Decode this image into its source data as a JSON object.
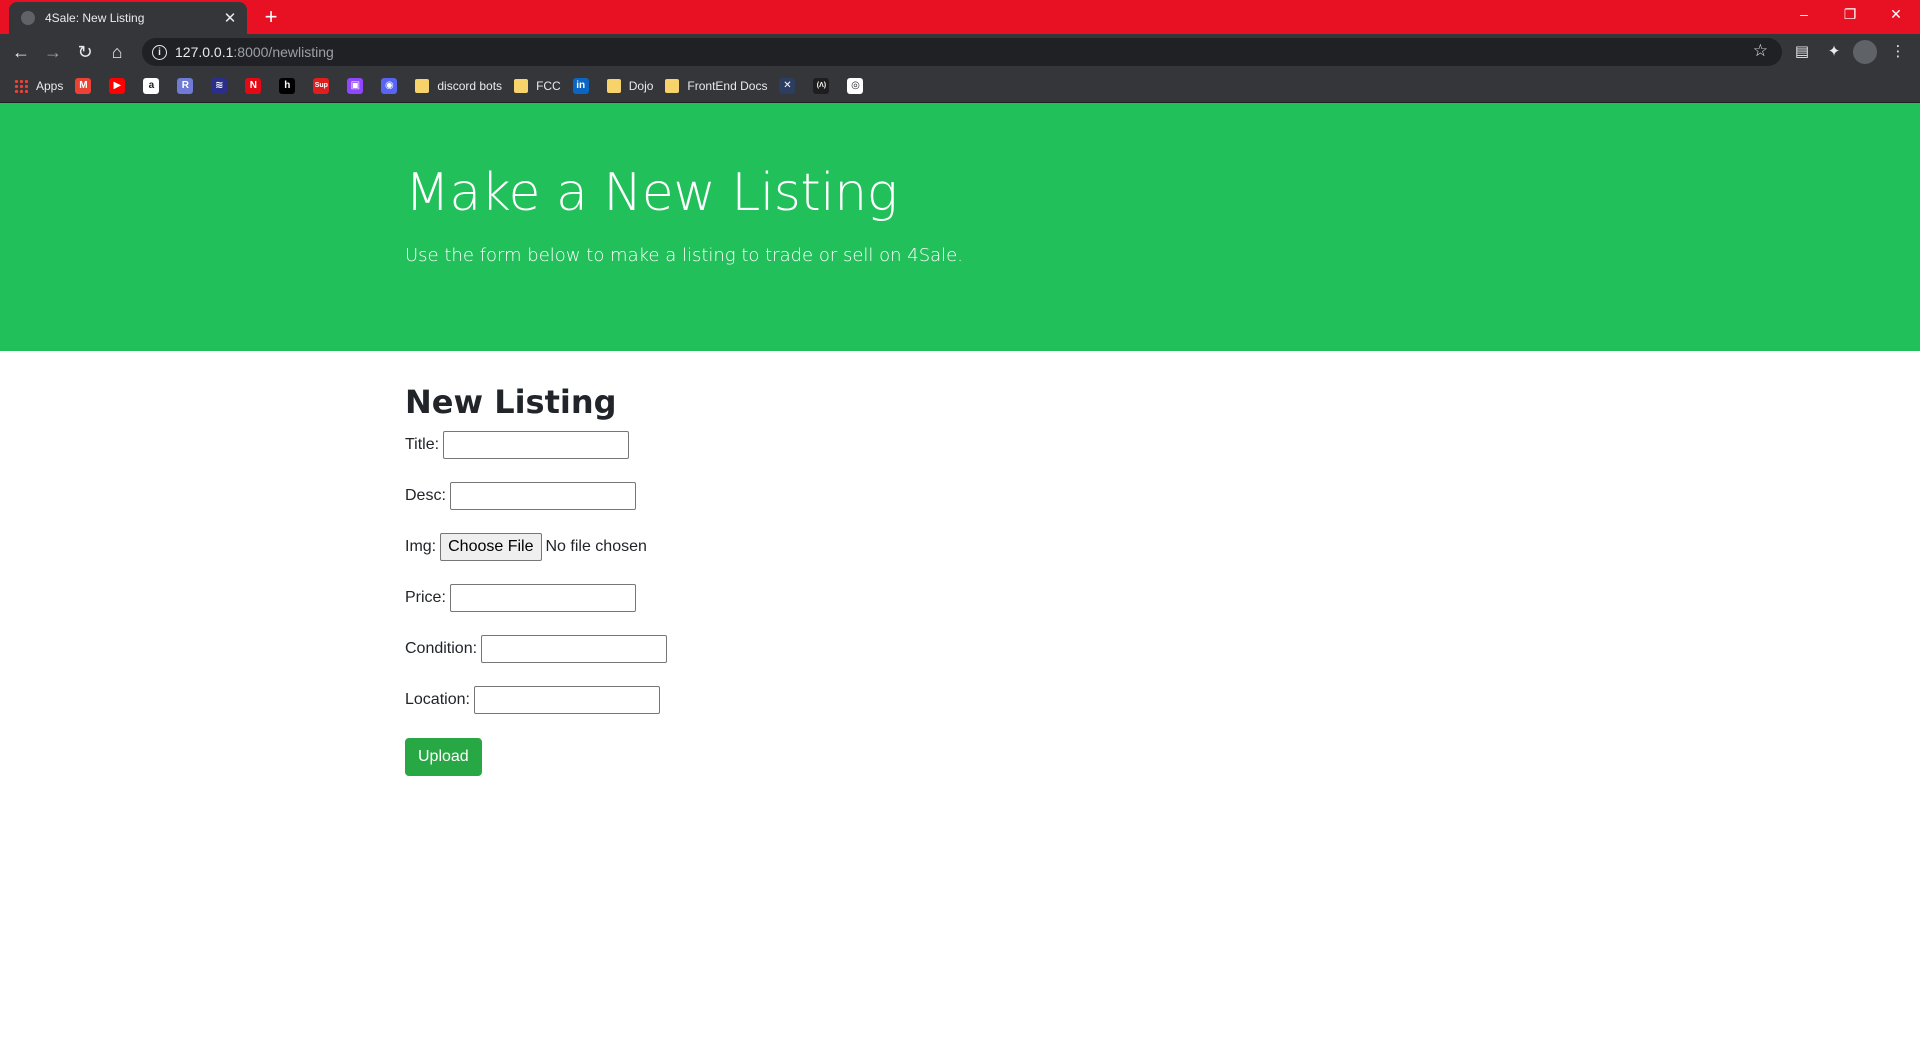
{
  "browser": {
    "tab_title": "4Sale: New Listing",
    "tab_close": "✕",
    "new_tab": "+",
    "url_host": "127.0.0.1",
    "url_path": ":8000/newlisting",
    "window_controls": {
      "minimize": "–",
      "restore": "❐",
      "close": "✕"
    },
    "bookmarks": [
      {
        "label": "Apps",
        "icon": "apps-grid-icon"
      },
      {
        "label": "",
        "icon": "gmail-icon",
        "color": "#ea4335",
        "glyph": "M"
      },
      {
        "label": "",
        "icon": "youtube-icon",
        "color": "#ff0000",
        "glyph": "▶"
      },
      {
        "label": "",
        "icon": "amazon-icon",
        "color": "#ffffff",
        "glyph": "a"
      },
      {
        "label": "",
        "icon": "bookmark-icon-4",
        "color": "#6f7bd6",
        "glyph": "R"
      },
      {
        "label": "",
        "icon": "bookmark-icon-5",
        "color": "#2b2f8a",
        "glyph": "≋"
      },
      {
        "label": "",
        "icon": "netflix-icon",
        "color": "#e50914",
        "glyph": "N"
      },
      {
        "label": "",
        "icon": "hulu-icon",
        "color": "#000000",
        "glyph": "h"
      },
      {
        "label": "",
        "icon": "supreme-icon",
        "color": "#e01e1e",
        "glyph": "Sup"
      },
      {
        "label": "",
        "icon": "twitch-icon",
        "color": "#9146ff",
        "glyph": "▣"
      },
      {
        "label": "",
        "icon": "discord-icon",
        "color": "#5865f2",
        "glyph": "◉"
      },
      {
        "label": "discord bots",
        "icon": "folder-icon"
      },
      {
        "label": "FCC",
        "icon": "folder-icon"
      },
      {
        "label": "",
        "icon": "linkedin-icon",
        "color": "#0a66c2",
        "glyph": "in"
      },
      {
        "label": "Dojo",
        "icon": "folder-icon"
      },
      {
        "label": "FrontEnd Docs",
        "icon": "folder-icon"
      },
      {
        "label": "",
        "icon": "bookmark-icon-x",
        "color": "#2c3e60",
        "glyph": "✕"
      },
      {
        "label": "",
        "icon": "bookmark-icon-lambda",
        "color": "#1e1e1e",
        "glyph": "(Λ)"
      },
      {
        "label": "",
        "icon": "github-icon",
        "color": "#ffffff",
        "glyph": "◎"
      }
    ]
  },
  "hero": {
    "title": "Make a New Listing",
    "subtitle": "Use the form below to make a listing to trade or sell on 4Sale."
  },
  "form": {
    "heading": "New Listing",
    "fields": {
      "title_label": "Title:",
      "desc_label": "Desc:",
      "img_label": "Img:",
      "choose_file": "Choose File",
      "no_file": "No file chosen",
      "price_label": "Price:",
      "condition_label": "Condition:",
      "location_label": "Location:"
    },
    "submit": "Upload"
  },
  "colors": {
    "titlebar": "#e81123",
    "hero_bg": "#22c05a",
    "button": "#28a745"
  }
}
